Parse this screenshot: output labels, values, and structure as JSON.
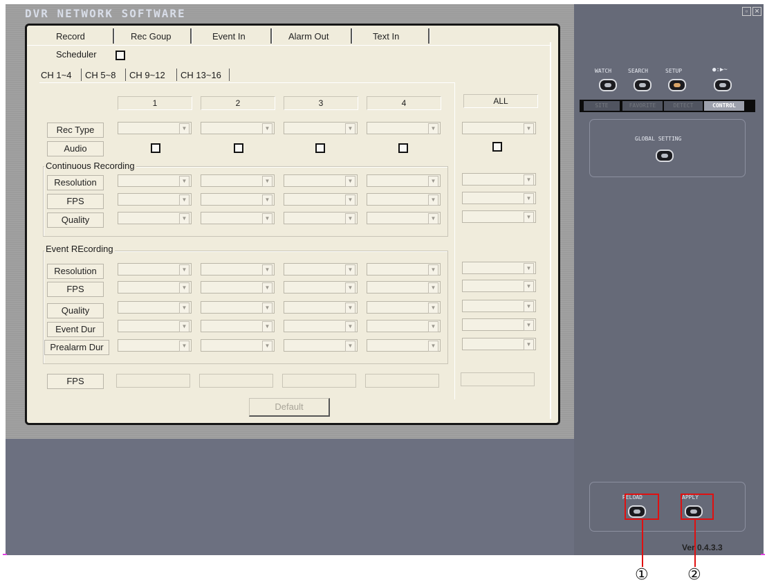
{
  "app": {
    "title": "DVR NETWORK SOFTWARE",
    "version": "Ver 0.4.3.3"
  },
  "tabs": [
    "Record",
    "Rec Goup",
    "Event In",
    "Alarm Out",
    "Text In"
  ],
  "scheduler_label": "Scheduler",
  "channel_tabs": [
    "CH 1~4",
    "CH 5~8",
    "CH 9~12",
    "CH 13~16"
  ],
  "columns": [
    "1",
    "2",
    "3",
    "4"
  ],
  "all_label": "ALL",
  "rows": {
    "rec_type": "Rec Type",
    "audio": "Audio",
    "continuous_title": "Continuous Recording",
    "resolution": "Resolution",
    "fps": "FPS",
    "quality": "Quality",
    "event_title": "Event REcording",
    "event_resolution": "Resolution",
    "event_fps": "FPS",
    "event_quality": "Quality",
    "event_dur": "Event Dur",
    "prealarm_dur": "Prealarm Dur",
    "fps_total": "FPS"
  },
  "default_button": "Default",
  "right_nav": {
    "watch": "WATCH",
    "search": "SEARCH",
    "setup": "SETUP",
    "exit": "●:▶~"
  },
  "right_tabs": [
    "SITE",
    "FAVORITE",
    "DETECT",
    "CONTROL"
  ],
  "global_setting": "GLOBAL SETTING",
  "reload": "RELOAD",
  "apply": "APPLY",
  "callouts": [
    "①",
    "②"
  ],
  "colors": {
    "panel_bg": "#f0ecdc",
    "right_bg": "#666a78",
    "callout": "#e01010"
  }
}
